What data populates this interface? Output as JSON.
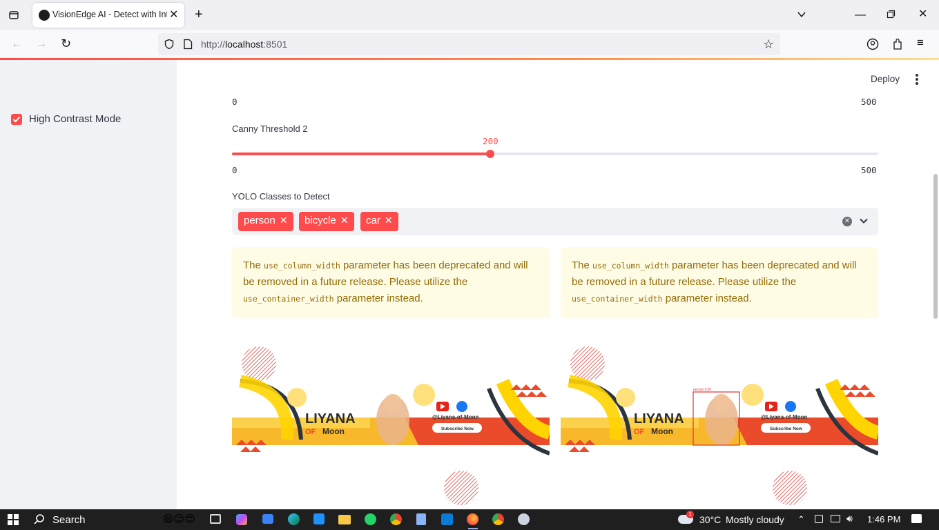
{
  "browser": {
    "tab_title": "VisionEdge AI - Detect with Inte",
    "url_scheme": "http://",
    "url_host": "localhost",
    "url_port": ":8501"
  },
  "sidebar": {
    "high_contrast_label": "High Contrast Mode",
    "high_contrast_checked": true
  },
  "header": {
    "deploy_label": "Deploy"
  },
  "slider1": {
    "min_label": "0",
    "max_label": "500"
  },
  "slider2": {
    "label": "Canny Threshold 2",
    "value": 200,
    "min": 0,
    "max": 500,
    "value_label": "200",
    "min_label": "0",
    "max_label": "500"
  },
  "yolo": {
    "label": "YOLO Classes to Detect",
    "chips": [
      "person",
      "bicycle",
      "car"
    ]
  },
  "warning": {
    "t1": "The ",
    "code1": "use_column_width",
    "t2": " parameter has been deprecated and will be removed in a future release. Please utilize the ",
    "code2": "use_container_width",
    "t3": " parameter instead."
  },
  "banner": {
    "brand1": "LIYANA",
    "brand2": "OF",
    "brand3": "Moon",
    "handle": "@Liyana-of-Moon",
    "subscribe": "Subscribe Now",
    "detect_label": "person 0.87"
  },
  "taskbar": {
    "search": "Search",
    "temp": "30°C",
    "weather": "Mostly cloudy",
    "time": "1:46 PM",
    "badge": "1"
  },
  "colors": {
    "accent": "#ff4b4b",
    "warn_bg": "#fffce6",
    "warn_text": "#926c05",
    "sidebar_bg": "#f0f2f6"
  }
}
